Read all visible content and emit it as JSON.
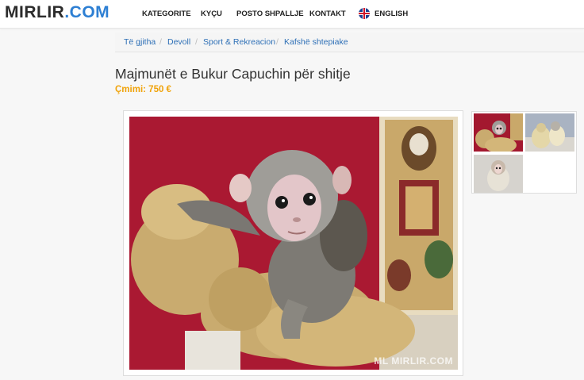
{
  "header": {
    "logo_part1": "MIRLIR",
    "logo_part2": ".COM",
    "nav": [
      "KATEGORITE",
      "KYÇU",
      "POSTO SHPALLJE",
      "KONTAKT",
      "ENGLISH"
    ]
  },
  "breadcrumb": [
    "Të gjitha",
    "Devoll",
    "Sport & Rekreacion",
    "Kafshë shtepiake"
  ],
  "listing": {
    "title": "Majmunët e Bukur Capuchin për shitje",
    "price": "Çmimi: 750 €"
  },
  "gallery": {
    "watermark": "ML MIRLIR.COM",
    "thumbnail_count": 3
  },
  "colors": {
    "logo_dark": "#2b2b2b",
    "logo_blue": "#2d7fd3",
    "link": "#2d6fb6",
    "price": "#f0a30a"
  }
}
